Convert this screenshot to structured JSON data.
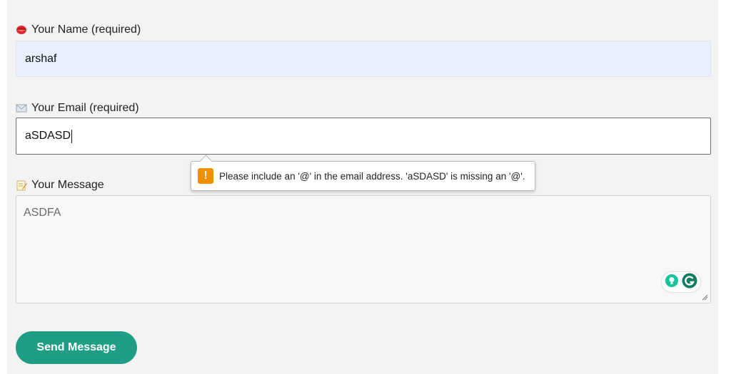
{
  "form": {
    "name": {
      "label": "Your Name (required)",
      "icon": "lips-icon",
      "value": "arshaf"
    },
    "email": {
      "label": "Your Email (required)",
      "icon": "envelope-icon",
      "value": "aSDASD"
    },
    "message": {
      "label": "Your Message",
      "icon": "memo-icon",
      "value": "ASDFA"
    },
    "submit_label": "Send Message"
  },
  "validation_tooltip": {
    "icon": "warning-icon",
    "symbol": "!",
    "text": "Please include an '@' in the email address. 'aSDASD' is missing an '@'."
  },
  "grammarly": {
    "icons": [
      "lightbulb-icon",
      "grammarly-g-icon"
    ]
  },
  "colors": {
    "accent": "#1f9e86",
    "autofill_bg": "#e8f0fe",
    "warning": "#f29100",
    "panel_bg": "#f3f3f3"
  }
}
